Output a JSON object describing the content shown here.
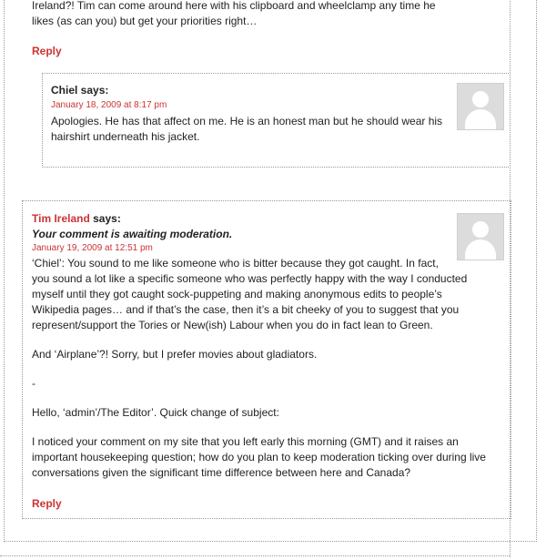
{
  "top_comment": {
    "text_line1": "Ireland?! Tim can come around here with his clipboard and wheelclamp any time he",
    "text_line2": "likes (as can you) but get your priorities right…",
    "reply": "Reply"
  },
  "reply_chiel": {
    "author": "Chiel",
    "says": " says:",
    "date": "January 18, 2009 at 8:17 pm",
    "text_line1": "Apologies. He has that affect on me. He is an honest man but he should wear his",
    "text_line2": "hairshirt underneath his jacket."
  },
  "tim_comment": {
    "author": "Tim Ireland",
    "says": " says:",
    "moderation": "Your comment is awaiting moderation.",
    "date": "January 19, 2009 at 12:51 pm",
    "paragraphs": [
      [
        "‘Chiel’: You sound to me like someone who is bitter because they got caught. In fact,",
        "you sound a lot like a specific someone who was perfectly happy with the way I conducted",
        "myself until they got caught sock-puppeting and making anonymous edits to people’s",
        "Wikipedia pages… and if that’s the case, then it’s a bit cheeky of you to suggest that you",
        "represent/support the Tories or New(ish) Labour when you do in fact lean to Green."
      ],
      [
        "And ‘Airplane’?! Sorry, but I prefer movies about gladiators."
      ],
      [
        "-"
      ],
      [
        "Hello, ‘admin’/The Editor’. Quick change of subject:"
      ],
      [
        "I noticed your comment on my site that you left early this morning (GMT) and it raises an",
        "important housekeeping question; how do you plan to keep moderation ticking over during live",
        "conversations given the significant time difference between here and Canada?"
      ]
    ],
    "reply": "Reply"
  }
}
